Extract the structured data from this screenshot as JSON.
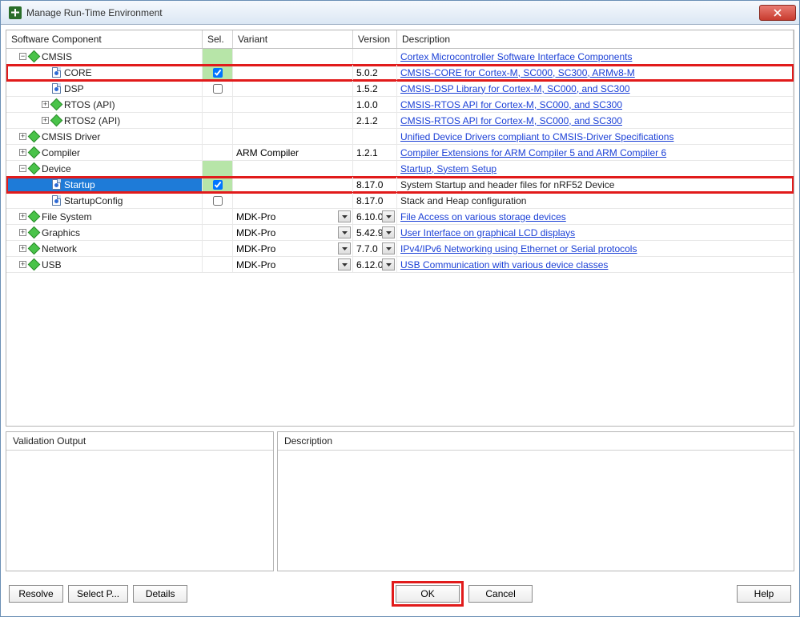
{
  "window": {
    "title": "Manage Run-Time Environment"
  },
  "columns": {
    "component": "Software Component",
    "sel": "Sel.",
    "variant": "Variant",
    "version": "Version",
    "description": "Description"
  },
  "rows": [
    {
      "indent": 0,
      "exp": "-",
      "icon": "diamond",
      "label": "CMSIS",
      "selBg": "green",
      "variant": "",
      "version": "",
      "desc": "Cortex Microcontroller Software Interface Components",
      "link": true,
      "hl": "",
      "selected": false
    },
    {
      "indent": 1,
      "exp": "",
      "icon": "file",
      "label": "CORE",
      "selBg": "green",
      "check": true,
      "variant": "",
      "version": "5.0.2",
      "desc": "CMSIS-CORE for Cortex-M, SC000, SC300, ARMv8-M",
      "link": true,
      "hl": "red",
      "selected": false
    },
    {
      "indent": 1,
      "exp": "",
      "icon": "file",
      "label": "DSP",
      "selBg": "",
      "check": false,
      "variant": "",
      "version": "1.5.2",
      "desc": "CMSIS-DSP Library for Cortex-M, SC000, and SC300",
      "link": true,
      "hl": "",
      "selected": false
    },
    {
      "indent": 1,
      "exp": "+",
      "icon": "diamond",
      "label": "RTOS (API)",
      "selBg": "",
      "variant": "",
      "version": "1.0.0",
      "desc": "CMSIS-RTOS API for Cortex-M, SC000, and SC300",
      "link": true,
      "hl": "",
      "selected": false
    },
    {
      "indent": 1,
      "exp": "+",
      "icon": "diamond",
      "label": "RTOS2 (API)",
      "selBg": "",
      "variant": "",
      "version": "2.1.2",
      "desc": "CMSIS-RTOS API for Cortex-M, SC000, and SC300",
      "link": true,
      "hl": "",
      "selected": false
    },
    {
      "indent": 0,
      "exp": "+",
      "icon": "diamond",
      "label": "CMSIS Driver",
      "selBg": "",
      "variant": "",
      "version": "",
      "desc": "Unified Device Drivers compliant to CMSIS-Driver Specifications",
      "link": true,
      "hl": "",
      "selected": false
    },
    {
      "indent": 0,
      "exp": "+",
      "icon": "diamond",
      "label": "Compiler",
      "selBg": "",
      "variant": "ARM Compiler",
      "version": "1.2.1",
      "desc": "Compiler Extensions for ARM Compiler 5 and ARM Compiler 6",
      "link": true,
      "hl": "",
      "selected": false
    },
    {
      "indent": 0,
      "exp": "-",
      "icon": "diamond",
      "label": "Device",
      "selBg": "green",
      "variant": "",
      "version": "",
      "desc": "Startup, System Setup",
      "link": true,
      "hl": "",
      "selected": false
    },
    {
      "indent": 1,
      "exp": "",
      "icon": "file",
      "label": "Startup",
      "selBg": "green",
      "check": true,
      "variant": "",
      "version": "8.17.0",
      "desc": "System Startup and header files for nRF52 Device",
      "link": false,
      "hl": "red",
      "selected": true
    },
    {
      "indent": 1,
      "exp": "",
      "icon": "file",
      "label": "StartupConfig",
      "selBg": "",
      "check": false,
      "variant": "",
      "version": "8.17.0",
      "desc": "Stack and Heap configuration",
      "link": false,
      "hl": "",
      "selected": false
    },
    {
      "indent": 0,
      "exp": "+",
      "icon": "diamond",
      "label": "File System",
      "selBg": "",
      "variant": "MDK-Pro",
      "variantDrop": true,
      "version": "6.10.0",
      "versionDrop": true,
      "desc": "File Access on various storage devices",
      "link": true,
      "hl": "",
      "selected": false
    },
    {
      "indent": 0,
      "exp": "+",
      "icon": "diamond",
      "label": "Graphics",
      "selBg": "",
      "variant": "MDK-Pro",
      "variantDrop": true,
      "version": "5.42.9",
      "versionDrop": true,
      "desc": "User Interface on graphical LCD displays",
      "link": true,
      "hl": "",
      "selected": false
    },
    {
      "indent": 0,
      "exp": "+",
      "icon": "diamond",
      "label": "Network",
      "selBg": "",
      "variant": "MDK-Pro",
      "variantDrop": true,
      "version": "7.7.0",
      "versionDrop": true,
      "desc": "IPv4/IPv6 Networking using Ethernet or Serial protocols",
      "link": true,
      "hl": "",
      "selected": false
    },
    {
      "indent": 0,
      "exp": "+",
      "icon": "diamond",
      "label": "USB",
      "selBg": "",
      "variant": "MDK-Pro",
      "variantDrop": true,
      "version": "6.12.0",
      "versionDrop": true,
      "desc": "USB Communication with various device classes",
      "link": true,
      "hl": "",
      "selected": false
    }
  ],
  "panes": {
    "validation_header": "Validation Output",
    "description_header": "Description"
  },
  "buttons": {
    "resolve": "Resolve",
    "select_p": "Select P...",
    "details": "Details",
    "ok": "OK",
    "cancel": "Cancel",
    "help": "Help"
  }
}
